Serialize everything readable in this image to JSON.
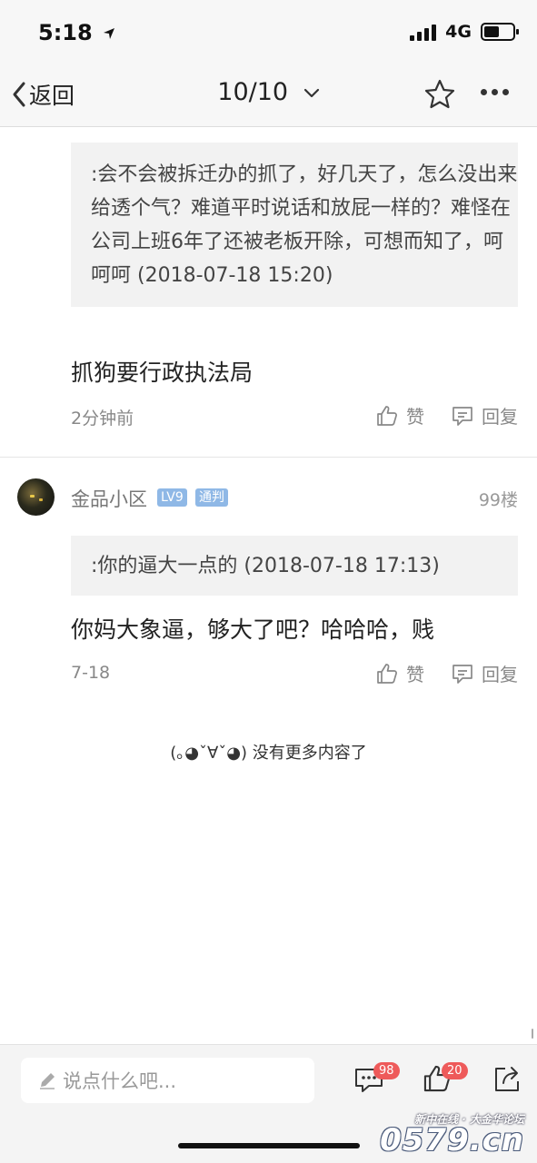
{
  "status": {
    "time": "5:18",
    "network": "4G"
  },
  "nav": {
    "back_label": "返回",
    "pager": "10/10"
  },
  "comment1": {
    "quote": ":会不会被拆迁办的抓了，好几天了，怎么没出来给透个气？难道平时说话和放屁一样的？难怪在公司上班6年了还被老板开除，可想而知了，呵呵呵 (2018-07-18 15:20)",
    "text": "抓狗要行政执法局",
    "time": "2分钟前",
    "like_label": "赞",
    "reply_label": "回复"
  },
  "comment2": {
    "username": "金品小区",
    "level_badge": "LV9",
    "role_badge": "通判",
    "floor": "99楼",
    "quote": ":你的逼大一点的 (2018-07-18 17:13)",
    "text": "你妈大象逼，够大了吧？哈哈哈，贱",
    "time": "7-18",
    "like_label": "赞",
    "reply_label": "回复"
  },
  "end_message": "(｡◕ˇ∀ˇ◕) 没有更多内容了",
  "bottom": {
    "input_placeholder": "说点什么吧...",
    "comment_count": "98",
    "like_count": "20"
  },
  "watermark": {
    "line1": "新中在线 · 大金华论坛",
    "line2": "0579.cn"
  },
  "colors": {
    "badge_blue": "#8fb8e6",
    "count_red": "#ee5a5a",
    "quote_bg": "#f2f2f2"
  },
  "icons": [
    "location-arrow-icon",
    "signal-icon",
    "battery-icon",
    "back-chevron-icon",
    "chevron-down-icon",
    "star-icon",
    "more-icon",
    "thumbs-up-icon",
    "comment-icon",
    "pencil-icon",
    "share-icon"
  ]
}
